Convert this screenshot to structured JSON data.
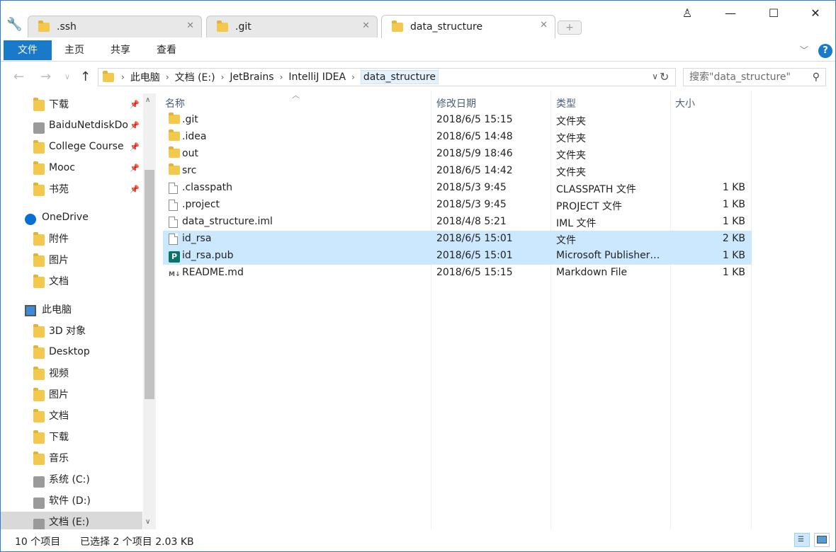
{
  "window": {
    "tabs": [
      {
        "label": ".ssh",
        "active": false
      },
      {
        "label": ".git",
        "active": false
      },
      {
        "label": "data_structure",
        "active": true
      }
    ],
    "new_tab": "+",
    "controls": {
      "user": "♙",
      "minimize": "—",
      "maximize": "☐",
      "close": "✕"
    }
  },
  "ribbon": {
    "file": "文件",
    "home": "主页",
    "share": "共享",
    "view": "查看",
    "help": "?"
  },
  "address": {
    "crumbs": [
      "此电脑",
      "文档 (E:)",
      "JetBrains",
      "IntelliJ IDEA",
      "data_structure"
    ],
    "separator": "›",
    "search_placeholder": "搜索\"data_structure\""
  },
  "sidebar": {
    "quick_access": [
      {
        "label": "下载",
        "icon": "download-folder-icon",
        "pinned": true
      },
      {
        "label": "BaiduNetdiskDownload",
        "icon": "drive-folder-icon",
        "pinned": true
      },
      {
        "label": "College Course",
        "icon": "folder-icon",
        "pinned": true
      },
      {
        "label": "Mooc",
        "icon": "folder-icon",
        "pinned": true
      },
      {
        "label": "书苑",
        "icon": "folder-icon",
        "pinned": true
      }
    ],
    "onedrive": {
      "label": "OneDrive",
      "items": [
        "附件",
        "图片",
        "文档"
      ]
    },
    "this_pc": {
      "label": "此电脑",
      "items": [
        "3D 对象",
        "Desktop",
        "视频",
        "图片",
        "文档",
        "下载",
        "音乐",
        "系统 (C:)",
        "软件 (D:)",
        "文档 (E:)"
      ]
    },
    "pin_glyph": "📌"
  },
  "filelist": {
    "headers": {
      "name": "名称",
      "modified": "修改日期",
      "type": "类型",
      "size": "大小"
    },
    "rows": [
      {
        "name": ".git",
        "modified": "2018/6/5 15:15",
        "type": "文件夹",
        "size": "",
        "icon": "folder-icon",
        "selected": false
      },
      {
        "name": ".idea",
        "modified": "2018/6/5 14:48",
        "type": "文件夹",
        "size": "",
        "icon": "folder-icon",
        "selected": false
      },
      {
        "name": "out",
        "modified": "2018/5/9 18:46",
        "type": "文件夹",
        "size": "",
        "icon": "folder-icon",
        "selected": false
      },
      {
        "name": "src",
        "modified": "2018/6/5 14:42",
        "type": "文件夹",
        "size": "",
        "icon": "folder-icon",
        "selected": false
      },
      {
        "name": ".classpath",
        "modified": "2018/5/3 9:45",
        "type": "CLASSPATH 文件",
        "size": "1 KB",
        "icon": "file-icon",
        "selected": false
      },
      {
        "name": ".project",
        "modified": "2018/5/3 9:45",
        "type": "PROJECT 文件",
        "size": "1 KB",
        "icon": "file-icon",
        "selected": false
      },
      {
        "name": "data_structure.iml",
        "modified": "2018/4/8 5:21",
        "type": "IML 文件",
        "size": "1 KB",
        "icon": "file-icon",
        "selected": false
      },
      {
        "name": "id_rsa",
        "modified": "2018/6/5 15:01",
        "type": "文件",
        "size": "2 KB",
        "icon": "file-icon",
        "selected": true
      },
      {
        "name": "id_rsa.pub",
        "modified": "2018/6/5 15:01",
        "type": "Microsoft Publisher…",
        "size": "1 KB",
        "icon": "publisher-icon",
        "selected": true
      },
      {
        "name": "README.md",
        "modified": "2018/6/5 15:15",
        "type": "Markdown File",
        "size": "1 KB",
        "icon": "markdown-icon",
        "selected": false
      }
    ]
  },
  "status": {
    "count": "10 个项目",
    "selection": "已选择 2 个项目  2.03 KB"
  },
  "colors": {
    "accent": "#1979ca",
    "selection": "#cce8ff",
    "header_text": "#4c607a"
  }
}
